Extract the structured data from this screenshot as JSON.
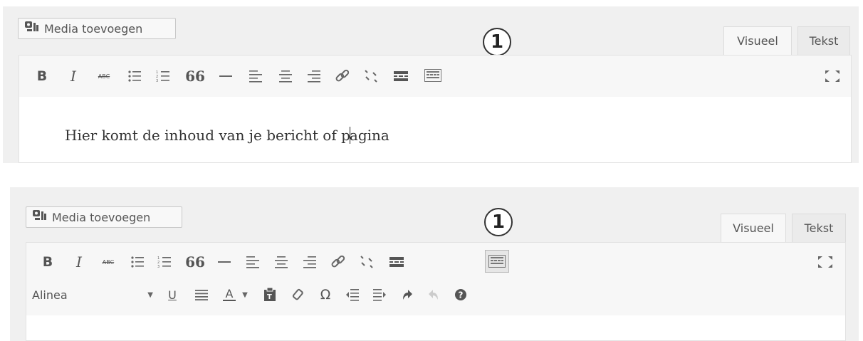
{
  "top": {
    "media_label": "Media toevoegen",
    "badge": "1",
    "tabs": {
      "visual": "Visueel",
      "text": "Tekst"
    },
    "content": {
      "before_caret": "Hier komt de inhoud van je bericht of p",
      "after_caret": "agina"
    },
    "toolbar": {
      "bold": "B",
      "italic": "I",
      "strike": "ABC",
      "blockquote": "66"
    }
  },
  "bottom": {
    "media_label": "Media toevoegen",
    "badge": "1",
    "tabs": {
      "visual": "Visueel",
      "text": "Tekst"
    },
    "toolbar": {
      "bold": "B",
      "italic": "I",
      "strike": "ABC",
      "blockquote": "66"
    },
    "toolbar2": {
      "format_value": "Alinea",
      "underline": "U",
      "text_color": "A",
      "omega": "Ω"
    }
  },
  "icons": [
    "media-add-icon",
    "bold-icon",
    "italic-icon",
    "strikethrough-icon",
    "bullet-list-icon",
    "numbered-list-icon",
    "blockquote-icon",
    "horizontal-line-icon",
    "align-left-icon",
    "align-center-icon",
    "align-right-icon",
    "link-icon",
    "unlink-icon",
    "read-more-icon",
    "toolbar-toggle-icon",
    "fullscreen-icon",
    "underline-icon",
    "justify-icon",
    "text-color-icon",
    "paste-text-icon",
    "clear-format-icon",
    "special-char-icon",
    "outdent-icon",
    "indent-icon",
    "undo-icon",
    "redo-icon",
    "help-icon"
  ],
  "colors": {
    "panel_bg": "#f0f0f0",
    "editor_bg": "#ffffff",
    "toolbar_bg": "#f7f7f7",
    "icon": "#555555"
  }
}
